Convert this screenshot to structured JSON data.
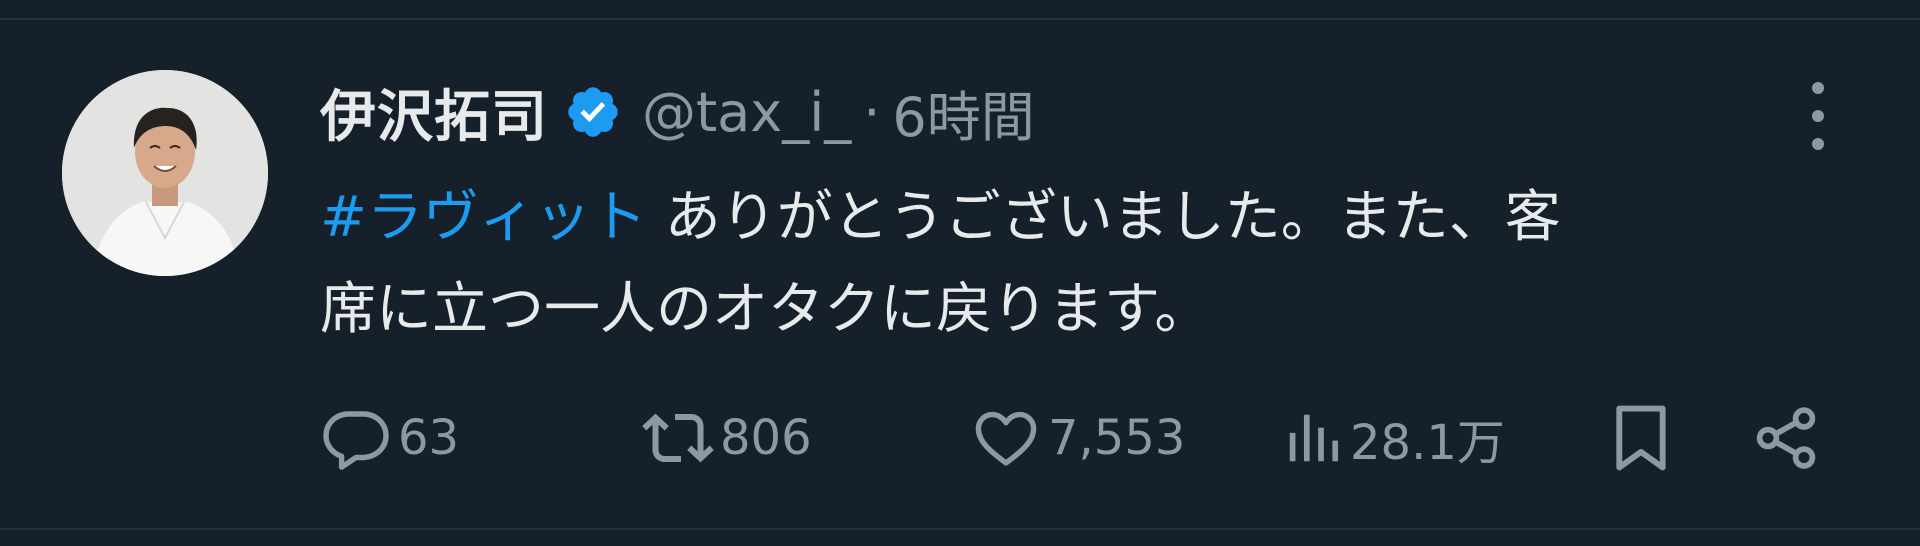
{
  "tweet": {
    "author": {
      "display_name": "伊沢拓司",
      "handle": "@tax_i_",
      "verified": true,
      "avatar_icon": "user-avatar-photo"
    },
    "separator": "·",
    "timestamp": "6時間",
    "text": {
      "hashtag": "#ラヴィット",
      "line1_rest": " ありがとうございました。また、客",
      "line2": "席に立つ一人のオタクに戻ります。"
    },
    "metrics": {
      "replies": "63",
      "retweets": "806",
      "likes": "7,553",
      "views": "28.1万"
    }
  },
  "icons": {
    "more": "more-vertical-icon",
    "reply": "reply-icon",
    "retweet": "retweet-icon",
    "like": "heart-icon",
    "views": "views-chart-icon",
    "bookmark": "bookmark-icon",
    "share": "share-icon",
    "verified": "verified-badge-icon"
  },
  "colors": {
    "background": "#15202b",
    "text": "#e7e9ea",
    "muted": "#8b98a5",
    "accent": "#1d9bf0"
  }
}
